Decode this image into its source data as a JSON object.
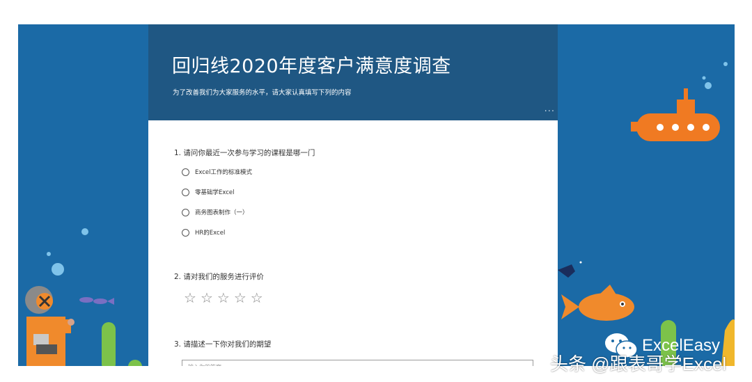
{
  "form": {
    "title": "回归线2020年度客户满意度调查",
    "subtitle": "为了改善我们为大家服务的水平，请大家认真填写下列的内容",
    "more_label": "···"
  },
  "questions": [
    {
      "title": "1. 请问你最近一次参与学习的课程是哪一门",
      "options": [
        "Excel工作的标准模式",
        "零基础学Excel",
        "商务图表制作（一）",
        "HR的Excel"
      ]
    },
    {
      "title": "2. 请对我们的服务进行评价",
      "rating": {
        "max": 5,
        "value": 0,
        "glyph": "☆"
      }
    },
    {
      "title": "3. 请描述一下你对我们的期望",
      "input_placeholder": "输入你的答案"
    }
  ],
  "watermark": {
    "account": "ExcelEasy",
    "author": "头条 @跟表哥学Excel"
  },
  "colors": {
    "background": "#1b6aa6",
    "header": "#1f5783",
    "fish": "#f08a2c",
    "submarine": "#f07a22"
  }
}
